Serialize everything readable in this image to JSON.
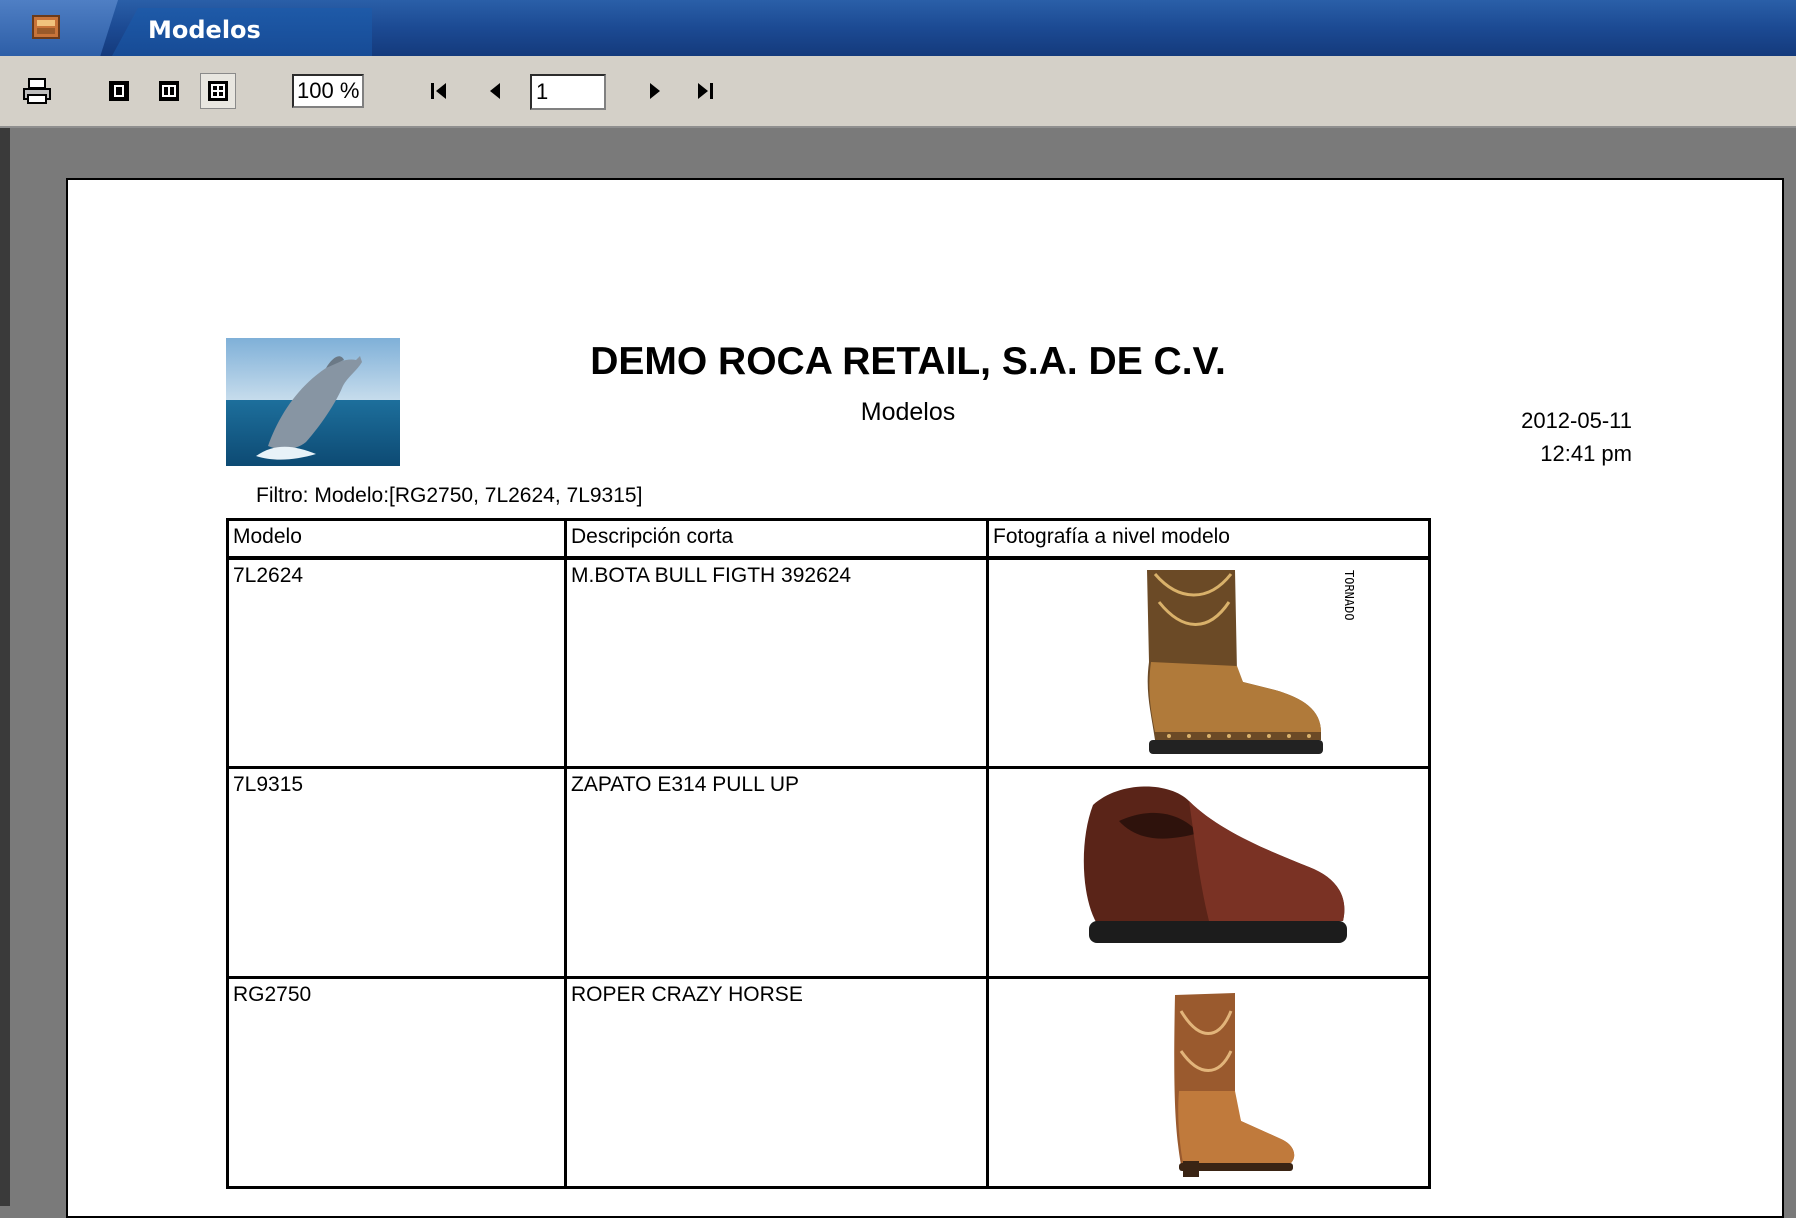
{
  "window": {
    "title": "Modelos"
  },
  "toolbar": {
    "zoom": "100 %",
    "page": "1",
    "icons": [
      "printer-icon",
      "single-page-icon",
      "two-page-icon",
      "multi-page-icon",
      "first-page-icon",
      "previous-page-icon",
      "next-page-icon",
      "last-page-icon"
    ]
  },
  "report": {
    "company": "DEMO ROCA RETAIL, S.A. DE C.V.",
    "subtitle": "Modelos",
    "date": "2012-05-11",
    "time": "12:41 pm",
    "filter": "Filtro:  Modelo:[RG2750, 7L2624, 7L9315]",
    "columns": [
      "Modelo",
      "Descripción corta",
      "Fotografía a nivel modelo"
    ],
    "rows": [
      {
        "modelo": "7L2624",
        "descripcion": "M.BOTA BULL FIGTH 392624",
        "photo": "work-boot",
        "brand_text": "TORNADO"
      },
      {
        "modelo": "7L9315",
        "descripcion": "ZAPATO E314 PULL UP",
        "photo": "slip-on-shoe"
      },
      {
        "modelo": "RG2750",
        "descripcion": "ROPER CRAZY HORSE",
        "photo": "roper-boot"
      }
    ]
  }
}
